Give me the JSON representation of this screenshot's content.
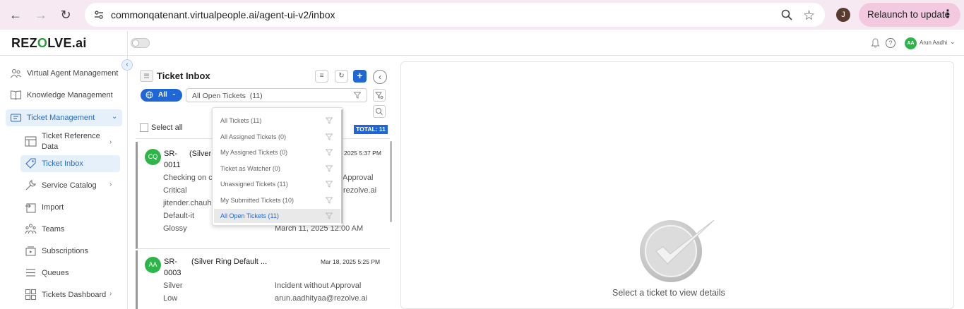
{
  "browser": {
    "url": "commonqatenant.virtualpeople.ai/agent-ui-v2/inbox",
    "profile_initial": "J",
    "relaunch_label": "Relaunch to update"
  },
  "app": {
    "logo_pre": "REZ",
    "logo_o": "O",
    "logo_post": "LVE.ai",
    "user_initials": "AA",
    "user_name": "Arun Aadhi"
  },
  "sidebar": {
    "items": [
      {
        "label": "Virtual Agent Management",
        "icon": "agents-icon"
      },
      {
        "label": "Knowledge Management",
        "icon": "book-icon"
      },
      {
        "label": "Ticket Management",
        "icon": "ticket-icon"
      }
    ],
    "subitems": [
      {
        "label": "Ticket Reference",
        "label2": "Data",
        "icon": "table-icon"
      },
      {
        "label": "Ticket Inbox",
        "icon": "tag-icon"
      },
      {
        "label": "Service Catalog",
        "icon": "wrench-icon"
      },
      {
        "label": "Import",
        "icon": "import-icon"
      },
      {
        "label": "Teams",
        "icon": "teams-icon"
      },
      {
        "label": "Subscriptions",
        "icon": "subscriptions-icon"
      },
      {
        "label": "Queues",
        "icon": "queues-icon"
      },
      {
        "label": "Tickets Dashboard",
        "icon": "dashboard-icon"
      }
    ]
  },
  "inbox": {
    "title": "Ticket Inbox",
    "all_label": "All",
    "filter_value": "All Open Tickets  (11)",
    "select_all": "Select all",
    "total": "TOTAL: 11"
  },
  "dropdown": {
    "items": [
      "All Tickets (11)",
      "All Assigned Tickets (0)",
      "My Assigned Tickets (0)",
      "Ticket as Watcher (0)",
      "Unassigned Tickets (11)",
      "My Submitted Tickets (10)",
      "All Open Tickets (11)"
    ],
    "selected_index": 6
  },
  "tickets": [
    {
      "initials": "CQ",
      "id1": "SR-",
      "id2": "0011",
      "title": "(Silver",
      "date": "2025 5:37 PM",
      "left": [
        "Checking on c",
        "Critical",
        "jitender.chauh",
        "Default-it",
        "Glossy"
      ],
      "right": [
        "Approval",
        "rezolve.ai",
        "",
        "",
        "March 11, 2025 12:00 AM"
      ]
    },
    {
      "initials": "AA",
      "id1": "SR-",
      "id2": "0003",
      "title": "(Silver Ring Default ...",
      "date": "Mar 18, 2025 5:25 PM",
      "left": [
        "Silver",
        "Low"
      ],
      "right": [
        "Incident without Approval",
        "arun.aadhityaa@rezolve.ai"
      ]
    }
  ],
  "details": {
    "empty_text": "Select a ticket to view details"
  },
  "colors": {
    "primary": "#1f67d6",
    "avatar_green": "#2eb54a",
    "sidebar_active": "#e6f0fa",
    "chrome_bg": "#f6e9f1"
  }
}
